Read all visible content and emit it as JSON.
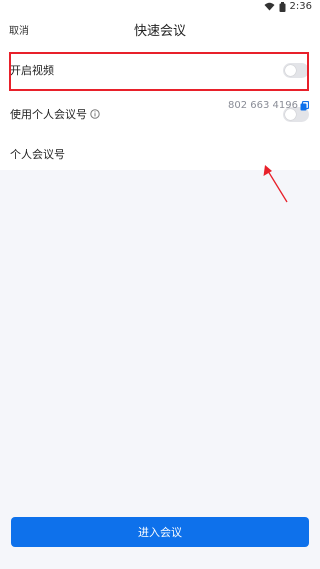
{
  "status_bar": {
    "time": "2:36",
    "icons": [
      "wifi-icon",
      "battery-icon"
    ]
  },
  "nav": {
    "cancel_label": "取消",
    "title": "快速会议"
  },
  "settings": {
    "video": {
      "label": "开启视频",
      "enabled": false
    },
    "personal_id": {
      "label": "使用个人会议号",
      "info_icon": "info-icon",
      "enabled": false
    },
    "personal_number": {
      "label": "个人会议号",
      "value": "802 663 4196",
      "copy_icon": "copy-icon"
    }
  },
  "annotations": {
    "highlight_color": "#e8202a",
    "arrow_color": "#e8202a"
  },
  "footer": {
    "enter_label": "进入会议",
    "button_color": "#0e71eb"
  }
}
